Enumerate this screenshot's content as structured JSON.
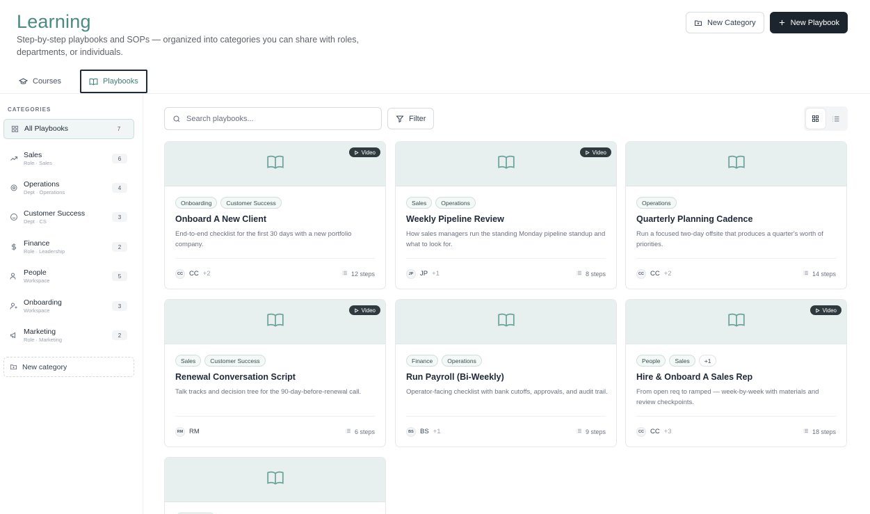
{
  "header": {
    "title": "Learning",
    "subtitle_line1": "Step-by-step playbooks and SOPs — organized into categories you can share with roles,",
    "subtitle_line2": "departments, or individuals.",
    "new_category_label": "New Category",
    "new_playbook_label": "New Playbook"
  },
  "tabs": [
    {
      "label": "Courses",
      "active": false
    },
    {
      "label": "Playbooks",
      "active": true
    }
  ],
  "sidebar": {
    "title": "CATEGORIES",
    "all": {
      "label": "All Playbooks",
      "count": "7"
    },
    "items": [
      {
        "name": "Sales",
        "sub": "Role · Sales",
        "count": "6",
        "icon": "trend-icon"
      },
      {
        "name": "Operations",
        "sub": "Dept · Operations",
        "count": "4",
        "icon": "cog-icon"
      },
      {
        "name": "Customer Success",
        "sub": "Dept · CS",
        "count": "3",
        "icon": "smile-icon"
      },
      {
        "name": "Finance",
        "sub": "Role · Leadership",
        "count": "2",
        "icon": "dollar-icon"
      },
      {
        "name": "People",
        "sub": "Workspace",
        "count": "5",
        "icon": "users-icon"
      },
      {
        "name": "Onboarding",
        "sub": "Workspace",
        "count": "3",
        "icon": "user-plus-icon"
      },
      {
        "name": "Marketing",
        "sub": "Role · Marketing",
        "count": "2",
        "icon": "megaphone-icon"
      }
    ],
    "new_category_label": "New category"
  },
  "toolbar": {
    "search_placeholder": "Search playbooks...",
    "filter_label": "Filter"
  },
  "cards": [
    {
      "video": "Video",
      "tags": [
        "Onboarding",
        "Customer Success"
      ],
      "title": "Onboard A New Client",
      "desc": "End-to-end checklist for the first 30 days with a new portfolio company.",
      "avatar": "CC",
      "owner": "CC",
      "extra": "+2",
      "steps": "12 steps"
    },
    {
      "video": "Video",
      "tags": [
        "Sales",
        "Operations"
      ],
      "title": "Weekly Pipeline Review",
      "desc": "How sales managers run the standing Monday pipeline standup and what to look for.",
      "avatar": "JP",
      "owner": "JP",
      "extra": "+1",
      "steps": "8 steps"
    },
    {
      "video": "",
      "tags": [
        "Operations"
      ],
      "title": "Quarterly Planning Cadence",
      "desc": "Run a focused two-day offsite that produces a quarter's worth of priorities.",
      "avatar": "CC",
      "owner": "CC",
      "extra": "+2",
      "steps": "14 steps"
    },
    {
      "video": "Video",
      "tags": [
        "Sales",
        "Customer Success"
      ],
      "title": "Renewal Conversation Script",
      "desc": "Talk tracks and decision tree for the 90-day-before-renewal call.",
      "avatar": "RM",
      "owner": "RM",
      "extra": "",
      "steps": "6 steps"
    },
    {
      "video": "",
      "tags": [
        "Finance",
        "Operations"
      ],
      "title": "Run Payroll (Bi-Weekly)",
      "desc": "Operator-facing checklist with bank cutoffs, approvals, and audit trail.",
      "avatar": "BS",
      "owner": "BS",
      "extra": "+1",
      "steps": "9 steps"
    },
    {
      "video": "Video",
      "tags": [
        "People",
        "Sales",
        "+1"
      ],
      "title": "Hire & Onboard A Sales Rep",
      "desc": "From open req to ramped — week-by-week with materials and review checkpoints.",
      "avatar": "CC",
      "owner": "CC",
      "extra": "+3",
      "steps": "18 steps"
    }
  ],
  "colors": {
    "accent": "#4a8a83",
    "dark_button": "#1c252e",
    "card_banner": "#e7f0ee"
  }
}
